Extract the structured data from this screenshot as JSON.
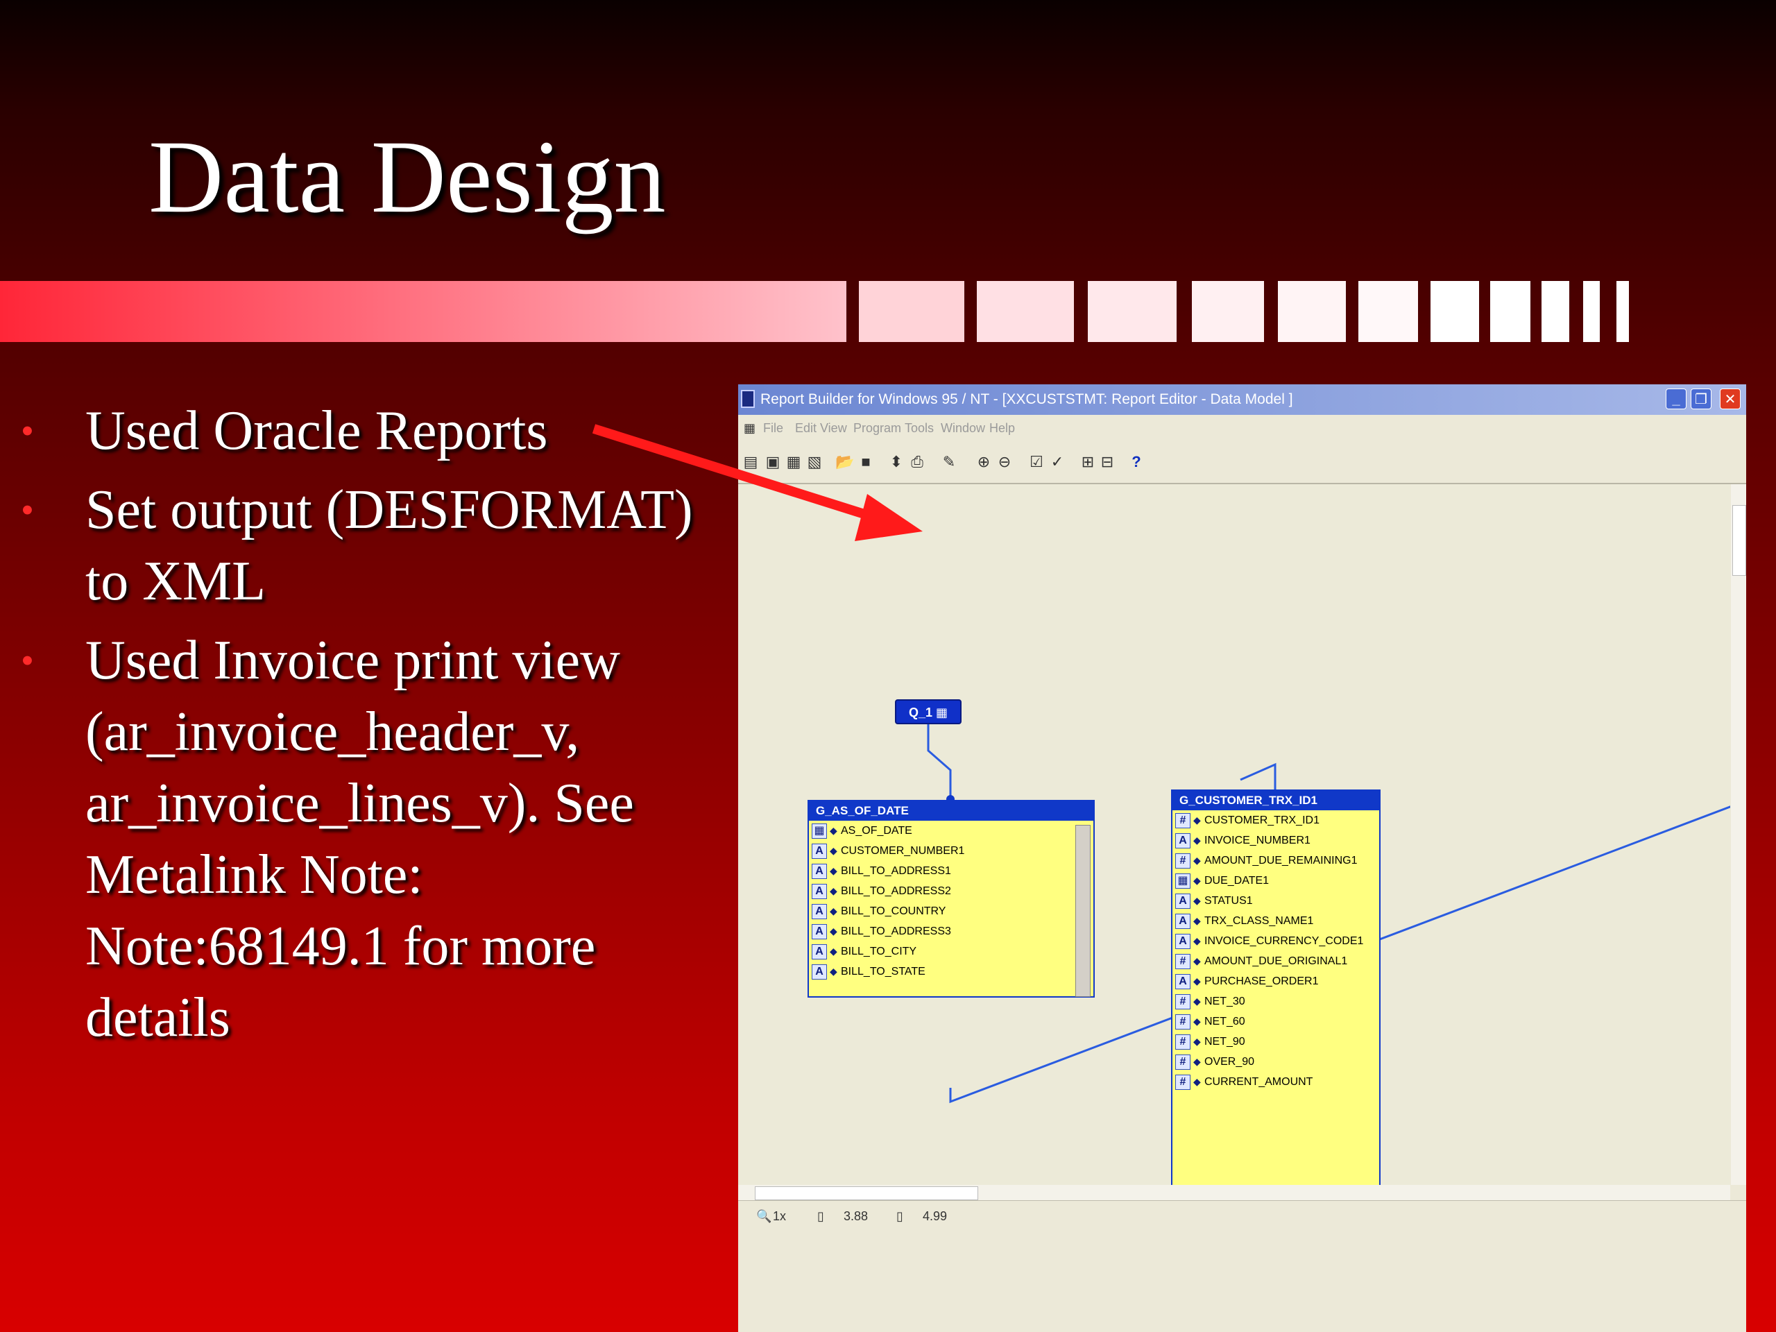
{
  "slide": {
    "title": "Data Design",
    "bullets": [
      "Used Oracle Reports",
      "Set output (DESFORMAT) to XML",
      "Used Invoice print view (ar_invoice_header_v, ar_invoice_lines_v). See Metalink Note: Note:68149.1 for more details"
    ],
    "bullet_color": "#ff2a2a",
    "arrow_color": "#ff1a1a"
  },
  "window": {
    "title": "Report Builder for Windows 95 / NT - [XXCUSTSTMT: Report Editor - Data Model ]",
    "menu": [
      "File",
      "Edit",
      "View",
      "Program",
      "Tools",
      "Window",
      "Help"
    ],
    "status": {
      "zoom": "1x",
      "x": "3.88",
      "y": "4.99"
    },
    "query": {
      "label": "Q_1"
    },
    "groups": [
      {
        "name": "G_AS_OF_DATE",
        "columns": [
          {
            "icon": "date",
            "name": "AS_OF_DATE"
          },
          {
            "icon": "A",
            "name": "CUSTOMER_NUMBER1"
          },
          {
            "icon": "A",
            "name": "BILL_TO_ADDRESS1"
          },
          {
            "icon": "A",
            "name": "BILL_TO_ADDRESS2"
          },
          {
            "icon": "A",
            "name": "BILL_TO_COUNTRY"
          },
          {
            "icon": "A",
            "name": "BILL_TO_ADDRESS3"
          },
          {
            "icon": "A",
            "name": "BILL_TO_CITY"
          },
          {
            "icon": "A",
            "name": "BILL_TO_STATE"
          }
        ]
      },
      {
        "name": "G_CUSTOMER_TRX_ID1",
        "columns": [
          {
            "icon": "num",
            "name": "CUSTOMER_TRX_ID1"
          },
          {
            "icon": "A",
            "name": "INVOICE_NUMBER1"
          },
          {
            "icon": "num",
            "name": "AMOUNT_DUE_REMAINING1"
          },
          {
            "icon": "date",
            "name": "DUE_DATE1"
          },
          {
            "icon": "A",
            "name": "STATUS1"
          },
          {
            "icon": "A",
            "name": "TRX_CLASS_NAME1"
          },
          {
            "icon": "A",
            "name": "INVOICE_CURRENCY_CODE1"
          },
          {
            "icon": "num",
            "name": "AMOUNT_DUE_ORIGINAL1"
          },
          {
            "icon": "A",
            "name": "PURCHASE_ORDER1"
          },
          {
            "icon": "num",
            "name": "NET_30"
          },
          {
            "icon": "num",
            "name": "NET_60"
          },
          {
            "icon": "num",
            "name": "NET_90"
          },
          {
            "icon": "num",
            "name": "OVER_90"
          },
          {
            "icon": "num",
            "name": "CURRENT_AMOUNT"
          }
        ]
      }
    ]
  }
}
